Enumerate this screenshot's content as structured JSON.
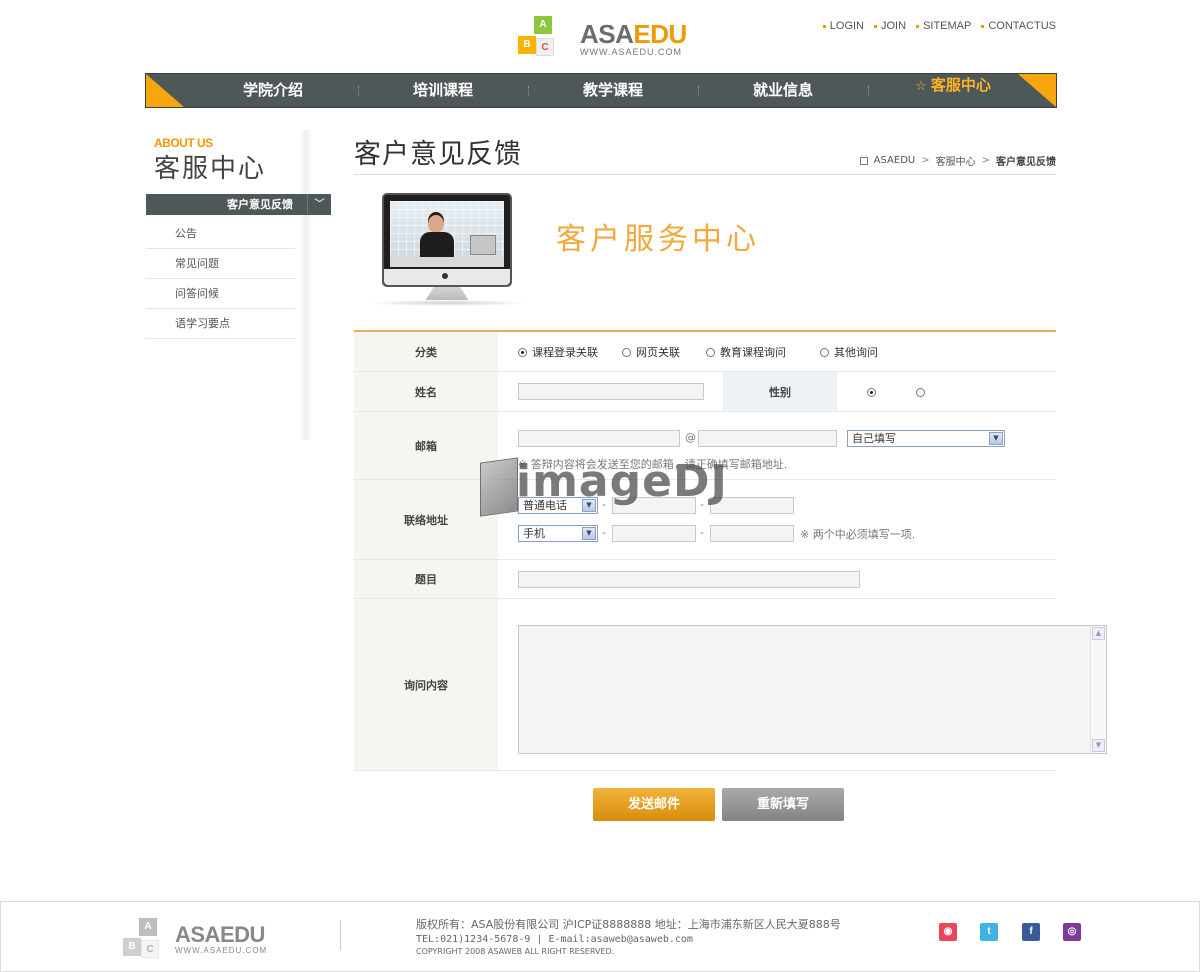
{
  "brand": {
    "logo_prefix": "ASA",
    "logo_suffix": "EDU",
    "logo_url": "WWW.ASAEDU.COM",
    "cube_a": "A",
    "cube_b": "B",
    "cube_c": "C",
    "accent_color": "#f19900",
    "nav_color": "#4f5859"
  },
  "top_links": [
    "LOGIN",
    "JOIN",
    "SITEMAP",
    "CONTACTUS"
  ],
  "main_nav": {
    "items": [
      "学院介绍",
      "培训课程",
      "教学课程",
      "就业信息",
      "客服中心"
    ],
    "active_index": 4,
    "active_icon": "star-icon"
  },
  "sidebar": {
    "heading_en": "ABOUT US",
    "heading_cn": "客服中心",
    "active_item": "客户意见反馈",
    "items": [
      "公告",
      "常见问题",
      "问答问候",
      "语学习要点"
    ]
  },
  "content": {
    "title": "客户意见反馈",
    "breadcrumb": [
      "ASAEDU",
      "客服中心",
      "客户意见反馈"
    ],
    "banner_title": "客户服务中心"
  },
  "form": {
    "category_label": "分类",
    "category_options": [
      "课程登录关联",
      "网页关联",
      "教育课程询问",
      "其他询问"
    ],
    "category_selected": 0,
    "name_label": "姓名",
    "name_value": "",
    "gender_label": "性别",
    "gender_selected": 0,
    "email_label": "邮箱",
    "email_user": "",
    "email_at": "@",
    "email_domain": "",
    "email_domain_select": "自己填写",
    "email_note": "※ 答辩内容将会发送至您的邮箱，请正确填写邮箱地址.",
    "address_label": "联络地址",
    "phone_type": "普通电话",
    "mobile_type": "手机",
    "phone_dash": "-",
    "phone_note": "※ 两个中必须填写一项.",
    "subject_label": "题目",
    "subject_value": "",
    "content_label": "询问内容",
    "content_value": ""
  },
  "buttons": {
    "send": "发送邮件",
    "reset": "重新填写"
  },
  "watermark": "imageDJ",
  "footer": {
    "line1": "版权所有：ASA股份有限公司 沪ICP证8888888 地址：上海市浦东新区人民大夏888号",
    "line2": "TEL:021)1234-5678-9 | E-mail:asaweb@asaweb.com",
    "line3": "COPYRIGHT 2008 ASAWEB ALL RIGHT RESERVED.",
    "social": [
      "weibo-icon",
      "twitter-icon",
      "facebook-icon",
      "message-icon"
    ],
    "social_glyphs": [
      "◉",
      "t",
      "f",
      "◎"
    ]
  }
}
